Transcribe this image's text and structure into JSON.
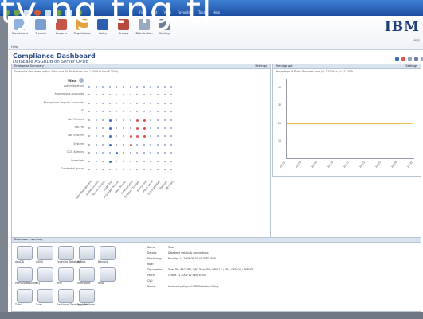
{
  "overlay": {
    "text": "ty ng tng tl"
  },
  "browser_menu": [
    "File",
    "Edit",
    "View",
    "Favorites",
    "Tools",
    "Help"
  ],
  "nav": {
    "items": [
      {
        "label": "Dashboard",
        "color": "#8fb3e0",
        "name": "dashboard"
      },
      {
        "label": "Threats",
        "color": "#7d9fcf",
        "name": "threats"
      },
      {
        "label": "Reports",
        "color": "#c8554a",
        "name": "reports"
      },
      {
        "label": "Regulations",
        "color": "#e3a33b",
        "name": "regulations"
      },
      {
        "label": "Policy",
        "color": "#2d5fb0",
        "name": "policy"
      },
      {
        "label": "Groups",
        "color": "#b84a3d",
        "name": "groups"
      },
      {
        "label": "Distribution",
        "color": "#9aa9bd",
        "name": "distribution"
      },
      {
        "label": "Settings",
        "color": "#6c7f9b",
        "name": "settings"
      }
    ],
    "sub": "Help",
    "logo": "IBM",
    "help": "Help"
  },
  "page": {
    "title": "Compliance Dashboard",
    "subtitle": "Database ASGRDB on Server OPDB"
  },
  "compliance_panel": {
    "header": "Enterprise Summary",
    "settings": "Settings",
    "note": "Enterprise (last event policy 'Who' and 'To What' from Nov 1 2009 to Nov 8 2009)",
    "who_label": "Who:",
    "rows": [
      "Administrators",
      "Anonymous Accounts",
      "Anonymous Regular Accounts",
      "IT",
      "Net Patrons",
      "Sar-HR",
      "Net System",
      "System",
      "CCM Admins",
      "Overview",
      "Credential group"
    ],
    "columns": [
      "User Management",
      "Authentication",
      "Access Control",
      "Audit Trail",
      "Privileged Access",
      "Data Access",
      "Configuration",
      "Schema Changes",
      "Encryption",
      "Patch Level",
      "Vulnerabilities",
      "Backups",
      "DB Users"
    ]
  },
  "trend_panel": {
    "header": "Trend graph",
    "settings": "Settings",
    "note": "Percentage of Policy Breaches from Jul 1 2009 to Jul 31 2009",
    "y_ticks": [
      "40",
      "30",
      "20",
      "10"
    ],
    "x_ticks": [
      "Jul 01",
      "Jul 05",
      "Jul 09",
      "Jul 13",
      "Jul 17",
      "Jul 21",
      "Jul 25",
      "Jul 29",
      "Jul 31"
    ],
    "red_line_value": 40,
    "yellow_line_value": 20
  },
  "db_panel": {
    "header": "Database Inventory",
    "icons": [
      "AppDB",
      "ASMS",
      "Ordering_Database",
      "AIRecs",
      "Banco4",
      "HumanResources",
      "HQ",
      "HRO",
      "Interwood",
      "RMA",
      "Tidal",
      "Trust",
      "Tractionor Trading_ph.Mali",
      "Tels_Mos.com"
    ],
    "props": [
      {
        "k": "Name:",
        "v": "Trust"
      },
      {
        "k": "Details:",
        "v": "Database details & connections"
      },
      {
        "k": "Monitoring:",
        "v": "Mon Apr 14 2008 09:30:41 GMT-0500"
      },
      {
        "k": "Role:",
        "v": ""
      },
      {
        "k": "Description:",
        "v": "Trust DB, 640 ORA, DB2 Trust DS / ORACLE / ERA / MSSQL / SYBASE"
      },
      {
        "k": "Patch:",
        "v": "Oracle 11.2009 12 Apr/Hi-Unit"
      },
      {
        "k": "CVE:",
        "v": ""
      },
      {
        "k": "Notes:",
        "v": "localhost.policy.ent.IBM.Database.Policy"
      }
    ]
  }
}
